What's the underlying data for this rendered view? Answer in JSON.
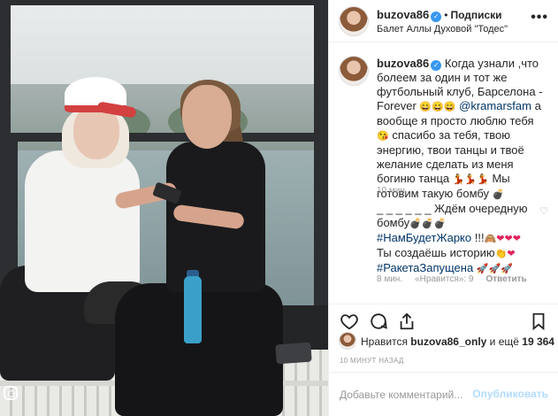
{
  "post": {
    "photo_label": "Post photo",
    "brand_cap_letter": "F"
  },
  "header": {
    "username": "buzova86",
    "verified_symbol": "✓",
    "dot": "•",
    "follow_label": "Подписки",
    "location": "Балет Аллы Духовой \"Тодес\"",
    "more_icon": "•••"
  },
  "caption": {
    "username": "buzova86",
    "text_before": " Когда узнали ,что болеем за один и тот же футбольный клуб, Барселона - Forever ",
    "laugh_emoji": "😄😄😄",
    "mention": "@kramarsfam",
    "text_mid": " а вообще я просто люблю тебя ",
    "blush_emoji": "😘",
    "text_after": " спасибо за тебя, твою энергию, твои танцы и твоё желание сделать из меня богиню танца ",
    "dancer_emoji": "💃💃💃",
    "text_end": " Мы готовим такую бомбу ",
    "bomb_emoji": "💣",
    "time": "10 мин."
  },
  "comment": {
    "text_line1": "_ _ _ _ _ _ Ждём очередную бомбу",
    "bombs": "💣💣💣",
    "tag1": "#НамБудетЖарко",
    "exclaim": " !!!",
    "emoji1": "🙈",
    "hearts1": "❤❤❤",
    "text_line3": "Ты создаёшь историю",
    "emoji2": "👏",
    "heart2": "❤",
    "tag2": "#РакетаЗапущена",
    "rockets": "🚀🚀🚀",
    "time": "8 мин.",
    "likes": "«Нравится»: 9",
    "reply": "Ответить",
    "like_icon": "♡"
  },
  "actions": {
    "like_icon": "heart-icon",
    "comment_icon": "comment-icon",
    "share_icon": "share-icon",
    "save_icon": "bookmark-icon"
  },
  "likes": {
    "prefix": "Нравится ",
    "user": "buzova86_only",
    "middle": " и ещё ",
    "count": "19 364"
  },
  "timestamp": "10 МИНУТ НАЗАД",
  "add_comment": {
    "placeholder": "Добавьте комментарий...",
    "publish_label": "Опубликовать"
  },
  "colors": {
    "link": "#003569",
    "verified": "#3897f0",
    "publish_disabled": "#b3dbff",
    "muted": "#999999"
  }
}
